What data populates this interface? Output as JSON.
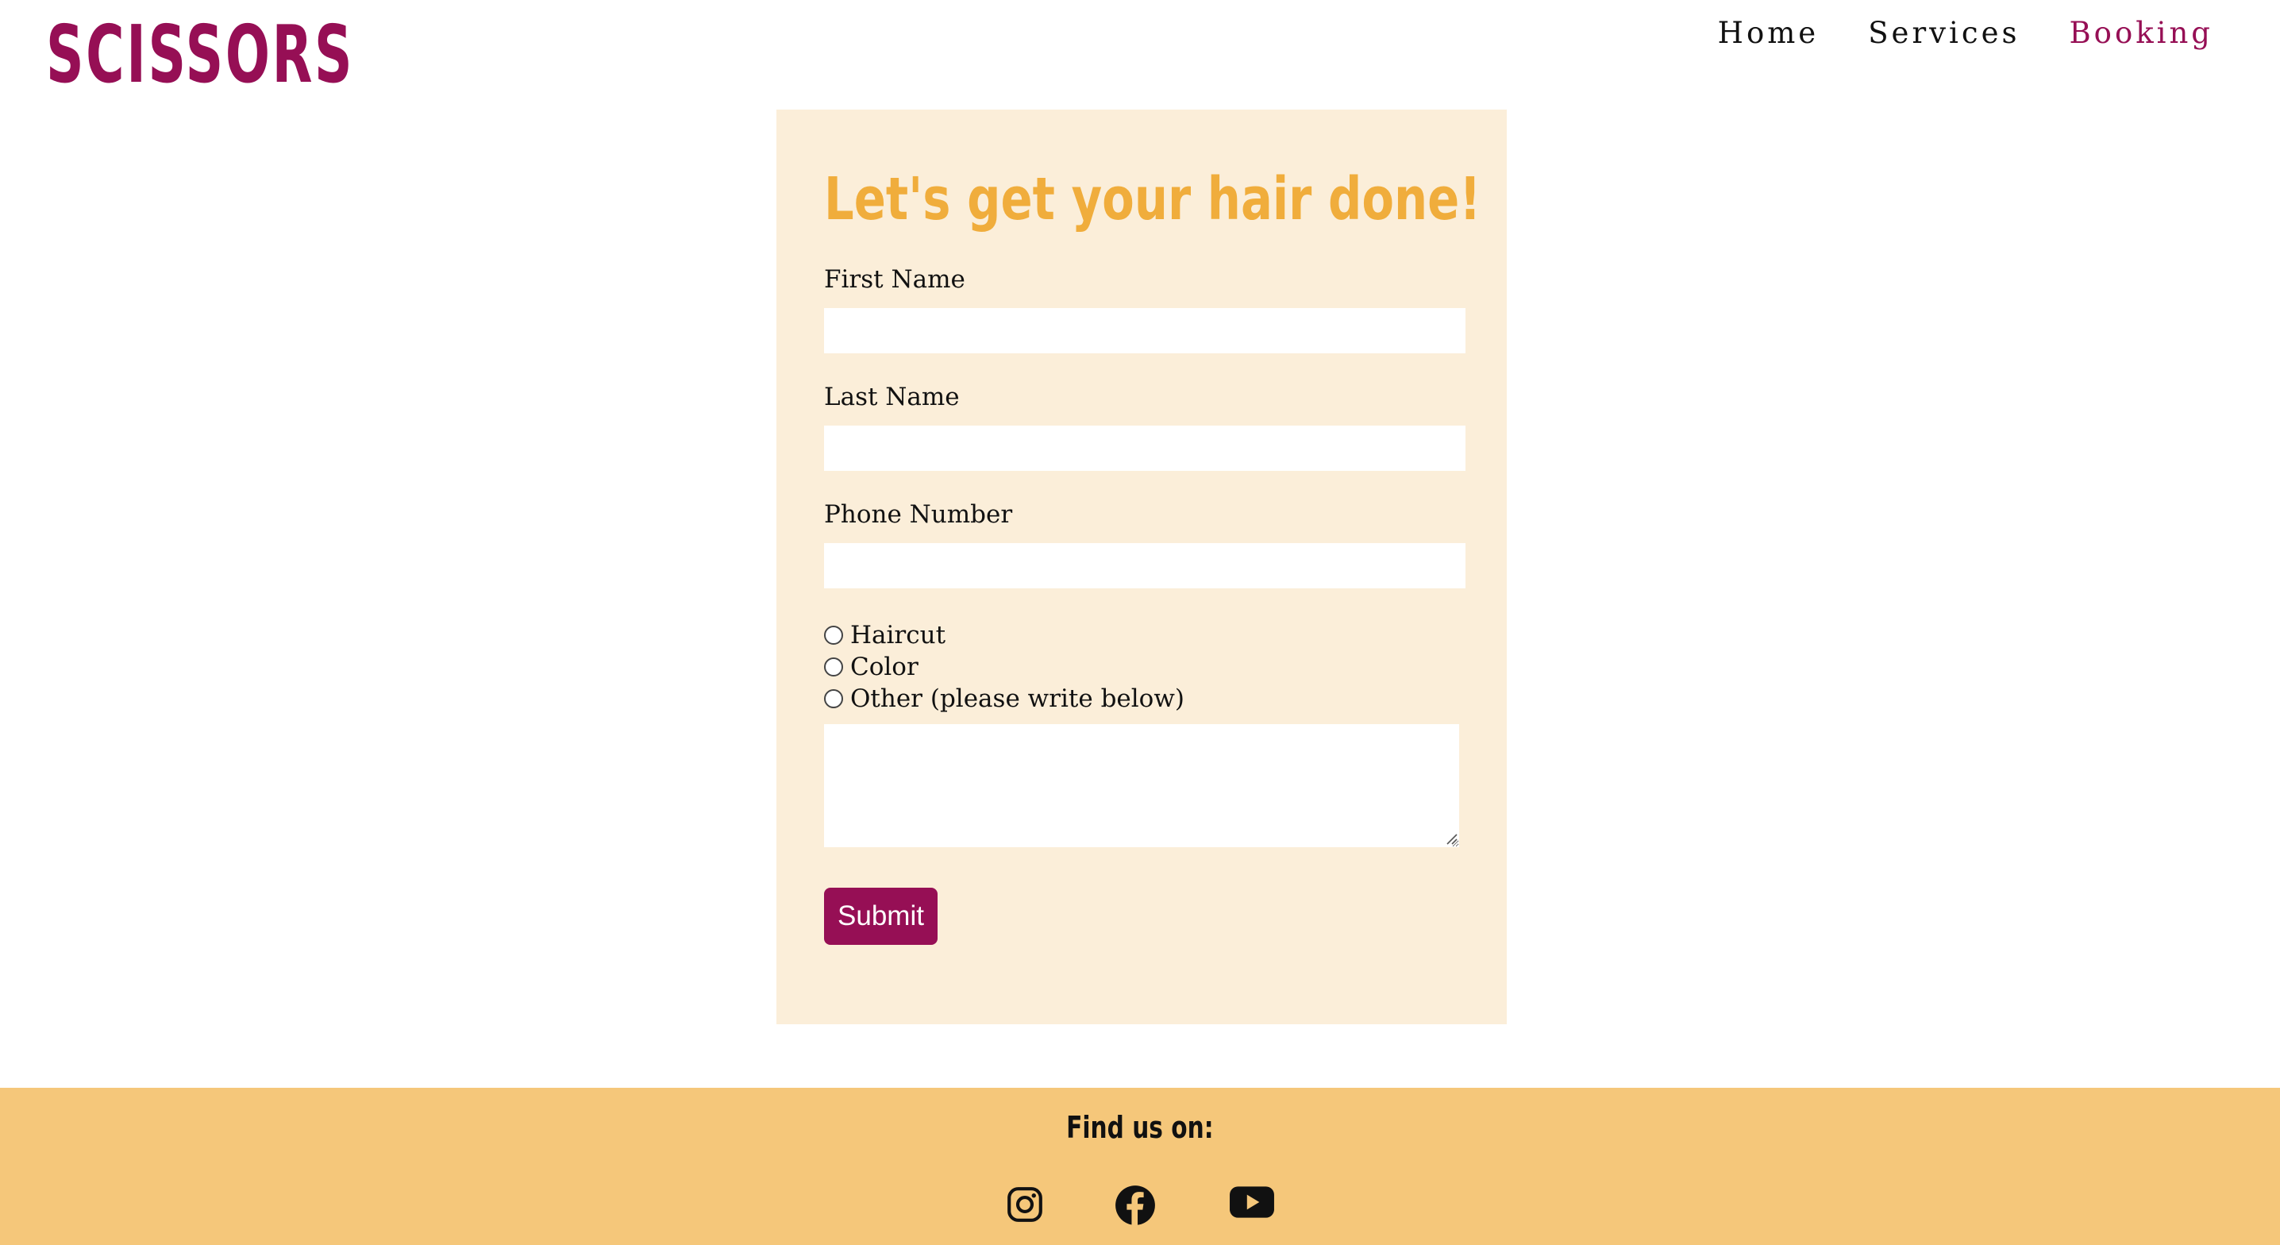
{
  "header": {
    "logo": "SCISSORS",
    "nav": [
      {
        "label": "Home",
        "active": false
      },
      {
        "label": "Services",
        "active": false
      },
      {
        "label": "Booking",
        "active": true
      }
    ]
  },
  "form": {
    "heading": "Let's get your hair done!",
    "first_name_label": "First Name",
    "first_name_value": "",
    "last_name_label": "Last Name",
    "last_name_value": "",
    "phone_label": "Phone Number",
    "phone_value": "",
    "services": [
      {
        "label": "Haircut",
        "selected": false
      },
      {
        "label": "Color",
        "selected": false
      },
      {
        "label": "Other (please write below)",
        "selected": false
      }
    ],
    "notes_value": "",
    "submit_label": "Submit"
  },
  "footer": {
    "title": "Find us on:",
    "social_icons": [
      "instagram-icon",
      "facebook-icon",
      "youtube-icon"
    ]
  },
  "colors": {
    "brand": "#960f55",
    "heading": "#f0ad3c",
    "card_bg": "#fbeed9",
    "footer_bg": "#f5c77a"
  }
}
